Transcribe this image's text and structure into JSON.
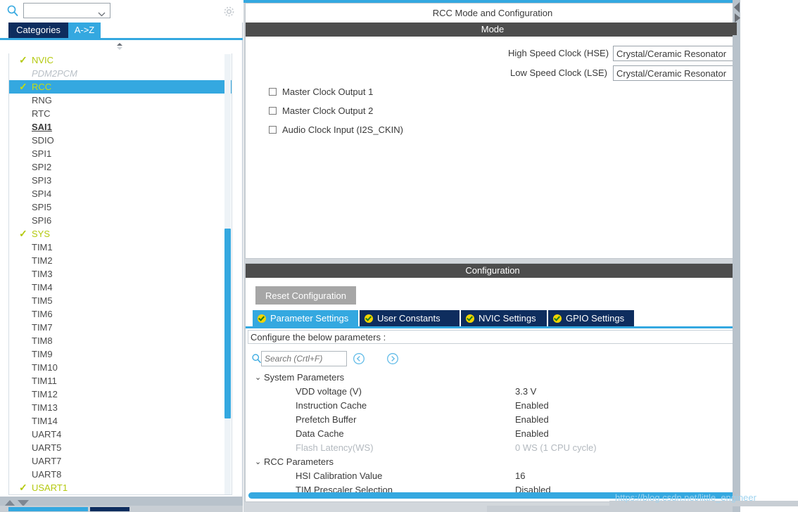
{
  "left_panel": {
    "search": {
      "value": "",
      "icon": "search-icon"
    },
    "gear_icon": "gear-icon",
    "tabs": [
      {
        "label": "Categories",
        "active": false
      },
      {
        "label": "A->Z",
        "active": true
      }
    ],
    "ip_list": [
      {
        "label": "NVIC",
        "state": "enabled"
      },
      {
        "label": "PDM2PCM",
        "state": "dim"
      },
      {
        "label": "RCC",
        "state": "selected"
      },
      {
        "label": "RNG",
        "state": "normal"
      },
      {
        "label": "RTC",
        "state": "normal"
      },
      {
        "label": "SAI1",
        "state": "warn"
      },
      {
        "label": "SDIO",
        "state": "normal"
      },
      {
        "label": "SPI1",
        "state": "normal"
      },
      {
        "label": "SPI2",
        "state": "normal"
      },
      {
        "label": "SPI3",
        "state": "normal"
      },
      {
        "label": "SPI4",
        "state": "normal"
      },
      {
        "label": "SPI5",
        "state": "normal"
      },
      {
        "label": "SPI6",
        "state": "normal"
      },
      {
        "label": "SYS",
        "state": "enabled"
      },
      {
        "label": "TIM1",
        "state": "normal"
      },
      {
        "label": "TIM2",
        "state": "normal"
      },
      {
        "label": "TIM3",
        "state": "normal"
      },
      {
        "label": "TIM4",
        "state": "normal"
      },
      {
        "label": "TIM5",
        "state": "normal"
      },
      {
        "label": "TIM6",
        "state": "normal"
      },
      {
        "label": "TIM7",
        "state": "normal"
      },
      {
        "label": "TIM8",
        "state": "normal"
      },
      {
        "label": "TIM9",
        "state": "normal"
      },
      {
        "label": "TIM10",
        "state": "normal"
      },
      {
        "label": "TIM11",
        "state": "normal"
      },
      {
        "label": "TIM12",
        "state": "normal"
      },
      {
        "label": "TIM13",
        "state": "normal"
      },
      {
        "label": "TIM14",
        "state": "normal"
      },
      {
        "label": "UART4",
        "state": "normal"
      },
      {
        "label": "UART5",
        "state": "normal"
      },
      {
        "label": "UART7",
        "state": "normal"
      },
      {
        "label": "UART8",
        "state": "normal"
      },
      {
        "label": "USART1",
        "state": "enabled"
      }
    ]
  },
  "mode_panel": {
    "title": "RCC Mode and Configuration",
    "section_header": "Mode",
    "selects": [
      {
        "label": "High Speed Clock (HSE)",
        "value": "Crystal/Ceramic Resonator"
      },
      {
        "label": "Low Speed Clock (LSE)",
        "value": "Crystal/Ceramic Resonator"
      }
    ],
    "checkboxes": [
      {
        "label": "Master Clock Output 1",
        "checked": false
      },
      {
        "label": "Master Clock Output 2",
        "checked": false
      },
      {
        "label": "Audio Clock Input (I2S_CKIN)",
        "checked": false
      }
    ]
  },
  "config_panel": {
    "header": "Configuration",
    "reset_button": "Reset Configuration",
    "tabs": [
      {
        "label": "Parameter Settings",
        "active": true
      },
      {
        "label": "User Constants",
        "active": false
      },
      {
        "label": "NVIC Settings",
        "active": false
      },
      {
        "label": "GPIO Settings",
        "active": false
      }
    ],
    "description": "Configure the below parameters :",
    "search": {
      "placeholder": "Search (Crtl+F)",
      "value": ""
    },
    "nav_prev_icon": "chevron-left-circle-icon",
    "nav_next_icon": "chevron-right-circle-icon",
    "parameter_groups": [
      {
        "name": "System Parameters",
        "expanded": true,
        "rows": [
          {
            "name": "VDD voltage (V)",
            "value": "3.3 V",
            "disabled": false
          },
          {
            "name": "Instruction Cache",
            "value": "Enabled",
            "disabled": false
          },
          {
            "name": "Prefetch Buffer",
            "value": "Enabled",
            "disabled": false
          },
          {
            "name": "Data Cache",
            "value": "Enabled",
            "disabled": false
          },
          {
            "name": "Flash Latency(WS)",
            "value": "0 WS (1 CPU cycle)",
            "disabled": true
          }
        ]
      },
      {
        "name": "RCC Parameters",
        "expanded": true,
        "rows": [
          {
            "name": "HSI Calibration Value",
            "value": "16",
            "disabled": false
          },
          {
            "name": "TIM Prescaler Selection",
            "value": "Disabled",
            "disabled": false
          }
        ]
      }
    ]
  },
  "watermark": "https://blog.csdn.net/little_engineer",
  "colors": {
    "accent_blue": "#34a8e0",
    "navy": "#0e2d5e",
    "enabled_green": "#b4c90f",
    "header_gray": "#4d4d4d",
    "badge_yellow": "#f2d400"
  }
}
